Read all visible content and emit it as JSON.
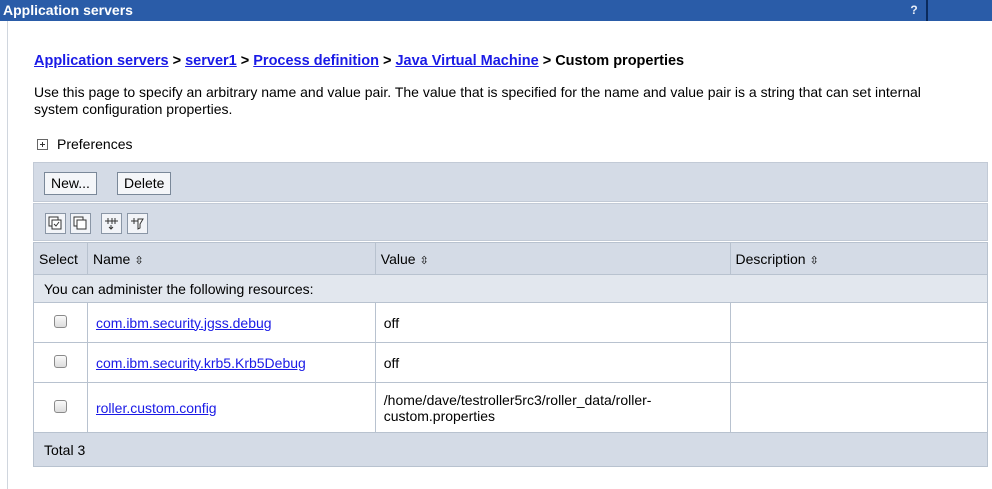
{
  "title_bar": {
    "title": "Application servers",
    "help": "?"
  },
  "breadcrumb": {
    "items": [
      "Application servers",
      "server1",
      "Process definition",
      "Java Virtual Machine"
    ],
    "separator": ">",
    "current": "Custom properties"
  },
  "description": "Use this page to specify an arbitrary name and value pair. The value that is specified for the name and value pair is a string that can set internal system configuration properties.",
  "preferences": {
    "label": "Preferences"
  },
  "buttons": {
    "new": "New...",
    "delete": "Delete"
  },
  "toolbar_icons": [
    "select-all-icon",
    "deselect-all-icon",
    "show-filter-icon",
    "clear-filter-icon"
  ],
  "table": {
    "headers": {
      "select": "Select",
      "name": "Name",
      "value": "Value",
      "description": "Description"
    },
    "sort_glyph": "⇳",
    "section_label": "You can administer the following resources:",
    "rows": [
      {
        "name": "com.ibm.security.jgss.debug",
        "value": "off",
        "description": ""
      },
      {
        "name": "com.ibm.security.krb5.Krb5Debug",
        "value": "off",
        "description": ""
      },
      {
        "name": "roller.custom.config",
        "value": "/home/dave/testroller5rc3/roller_data/roller-custom.properties",
        "description": ""
      }
    ],
    "total": "Total 3"
  },
  "colors": {
    "title_bar": "#2a5ca8",
    "link": "#1a1ae6",
    "panel": "#d4dbe6"
  }
}
